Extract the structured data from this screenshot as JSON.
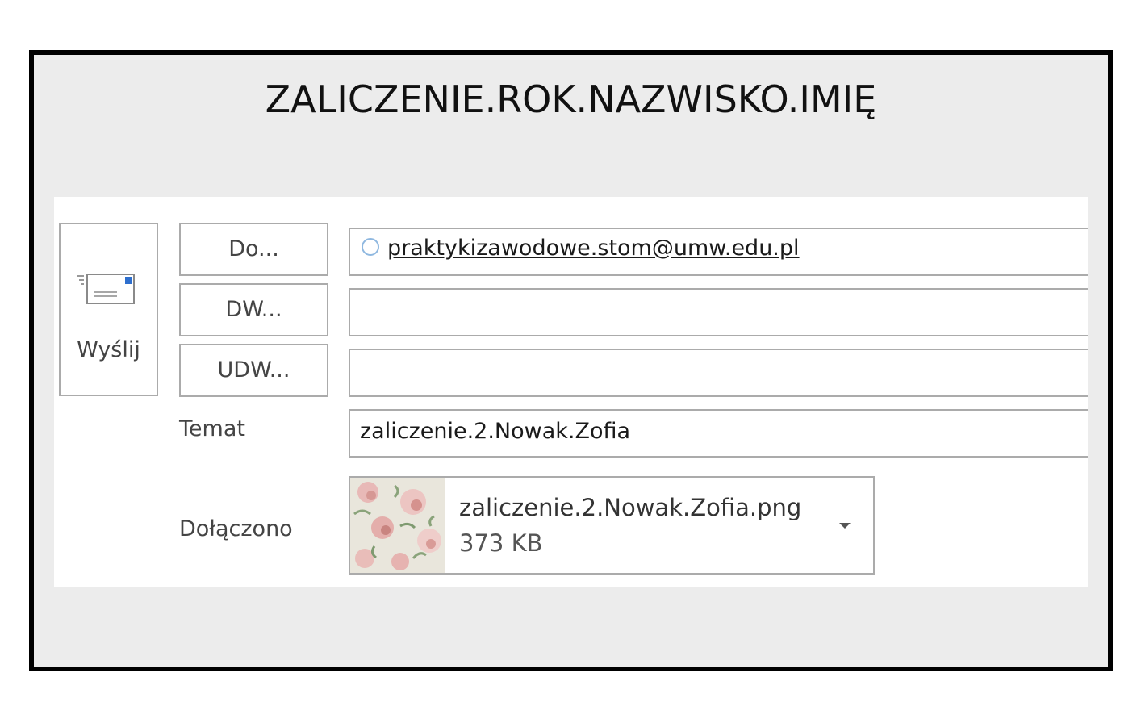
{
  "headline": "ZALICZENIE.ROK.NAZWISKO.IMIĘ",
  "compose": {
    "send_label": "Wyślij",
    "send_icon": "send-envelope-icon",
    "to_button_label": "Do...",
    "cc_button_label": "DW...",
    "bcc_button_label": "UDW...",
    "to_value": "praktykizawodowe.stom@umw.edu.pl",
    "cc_value": "",
    "bcc_value": "",
    "subject_label": "Temat",
    "subject_value": "zaliczenie.2.Nowak.Zofia",
    "attached_label": "Dołączono",
    "attachment": {
      "name": "zaliczenie.2.Nowak.Zofia.png",
      "size": "373 KB",
      "thumbnail_icon": "floral-image-thumbnail",
      "menu_icon": "chevron-down-icon"
    }
  },
  "colors": {
    "frame_border": "#000000",
    "frame_background": "#ececec",
    "panel_background": "#ffffff",
    "control_border": "#ababab",
    "envelope_accent": "#2e6fce",
    "recipient_circle": "#8fb8e0"
  }
}
